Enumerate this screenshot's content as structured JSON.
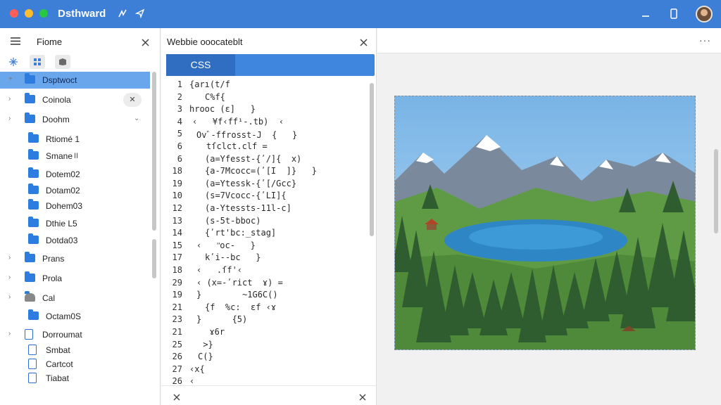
{
  "window": {
    "title": "Dsthward",
    "traffic_lights": [
      "#ff5f57",
      "#febc2e",
      "#28c840"
    ],
    "accent": "#3d7fd6"
  },
  "sidebar": {
    "title": "Fiome",
    "tools": [
      "sparkle-icon",
      "grid-icon",
      "package-icon"
    ],
    "items": [
      {
        "label": "Dsptwoct",
        "type": "folder",
        "selected": true,
        "chevron": "+"
      },
      {
        "label": "Coinola",
        "type": "folder",
        "chevron": "›",
        "badge": "✕"
      },
      {
        "label": "Doohm",
        "type": "folder",
        "chevron": "›",
        "expanded": true
      },
      {
        "label": "Rtiomé 1",
        "type": "folder"
      },
      {
        "label": "Smane",
        "type": "folder",
        "badge": "II"
      },
      {
        "label": "Dotem02",
        "type": "folder"
      },
      {
        "label": "Dotam02",
        "type": "folder"
      },
      {
        "label": "Dohem03",
        "type": "folder"
      },
      {
        "label": "Dthie L5",
        "type": "folder"
      },
      {
        "label": "Dotda03",
        "type": "folder"
      },
      {
        "label": "Prans",
        "type": "folder",
        "chevron": "›"
      },
      {
        "label": "Prola",
        "type": "folder",
        "chevron": "›"
      },
      {
        "label": "Cal",
        "type": "user",
        "chevron": "›"
      },
      {
        "label": "Octam0S",
        "type": "folder"
      },
      {
        "label": "Dorroumat",
        "type": "file",
        "chevron": "›"
      },
      {
        "label": "Smbat",
        "type": "file"
      },
      {
        "label": "Cartcot",
        "type": "file"
      },
      {
        "label": "Tiabat",
        "type": "file"
      }
    ]
  },
  "editor": {
    "title": "Webbie ooocateblt",
    "tab_label": "CSS",
    "lines": [
      {
        "n": "1",
        "text": "{arı(t/f",
        "indent": 0
      },
      {
        "n": "2",
        "text": "C%f{",
        "indent": 22
      },
      {
        "n": "3",
        "text": "hrooc (ɛ]   }",
        "indent": 0
      },
      {
        "n": "4",
        "text": "‹   ¥f‹ff¹-.tb)  ‹",
        "indent": 4
      },
      {
        "n": "5",
        "text": "Ovﾞ-ffrosst-J  {   }",
        "indent": 10
      },
      {
        "n": "6",
        "text": "tſclct.clf =",
        "indent": 24
      },
      {
        "n": "6",
        "text": "(a=Yfesst-{ʹ/]{  x)",
        "indent": 22
      },
      {
        "n": "18",
        "text": "{a-7Mcocc=(ʹ[I  ]}   }",
        "indent": 22
      },
      {
        "n": "19",
        "text": "(a=Ytessk-{ʹ[/Gcc}",
        "indent": 22
      },
      {
        "n": "10",
        "text": "(s=7Vcocc-{ʹLI]{",
        "indent": 22
      },
      {
        "n": "12",
        "text": "(a-Ytessts-11l-c]",
        "indent": 22
      },
      {
        "n": "13",
        "text": "(s-5t-bboc)",
        "indent": 22
      },
      {
        "n": "14",
        "text": "{ʹrt'bc:_stag]",
        "indent": 22
      },
      {
        "n": "15",
        "text": "‹   ʺoc-   }",
        "indent": 10
      },
      {
        "n": "17",
        "text": "kʹi--bc   }",
        "indent": 22
      },
      {
        "n": "18",
        "text": "‹   .ſf'‹",
        "indent": 10
      },
      {
        "n": "29",
        "text": "‹ (x=-ʹrict  ɤ) =",
        "indent": 10
      },
      {
        "n": "19",
        "text": "}        ~1G6C()",
        "indent": 10
      },
      {
        "n": "21",
        "text": "{f  %c:  ɛf ‹ɤ",
        "indent": 22
      },
      {
        "n": "23",
        "text": "}      {5)",
        "indent": 10
      },
      {
        "n": "21",
        "text": "  ɤ6r",
        "indent": 14
      },
      {
        "n": "25",
        "text": " >}",
        "indent": 12
      },
      {
        "n": "26",
        "text": "C(}",
        "indent": 12
      },
      {
        "n": "27",
        "text": "‹x{",
        "indent": 0
      },
      {
        "n": "26",
        "text": "‹",
        "indent": 0
      }
    ]
  },
  "preview": {
    "menu_label": "···"
  }
}
